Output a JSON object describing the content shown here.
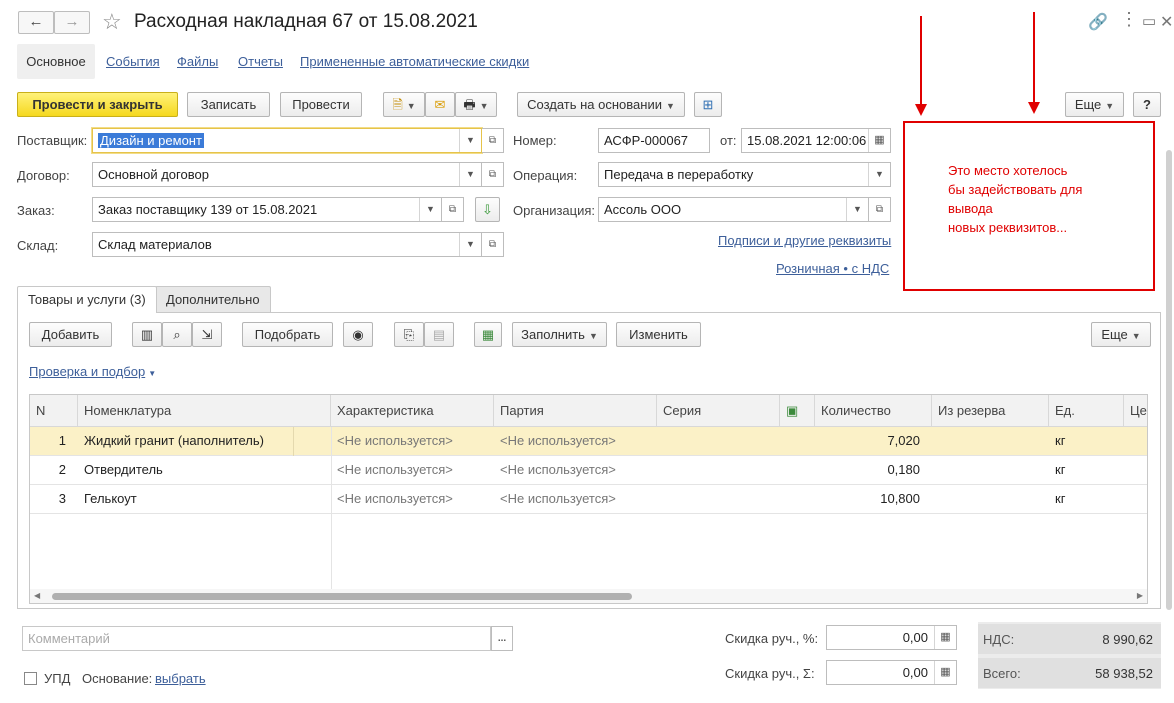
{
  "header": {
    "title": "Расходная накладная 67 от 15.08.2021",
    "back_glyph": "🡐",
    "forward_glyph": "🡒"
  },
  "top_tabs": [
    {
      "label": "Основное"
    },
    {
      "label": "События"
    },
    {
      "label": "Файлы"
    },
    {
      "label": "Отчеты"
    },
    {
      "label": "Примененные автоматические скидки"
    }
  ],
  "toolbar": {
    "post_close": "Провести и закрыть",
    "save": "Записать",
    "post": "Провести",
    "create_based": "Создать на основании",
    "more": "Еще",
    "help": "?"
  },
  "form": {
    "supplier_label": "Поставщик:",
    "supplier_value": "Дизайн и ремонт",
    "contract_label": "Договор:",
    "contract_value": "Основной договор",
    "order_label": "Заказ:",
    "order_value": "Заказ поставщику 139 от 15.08.2021",
    "warehouse_label": "Склад:",
    "warehouse_value": "Склад материалов",
    "number_label": "Номер:",
    "number_value": "АСФР-000067",
    "date_label": "от:",
    "date_value": "15.08.2021 12:00:06",
    "operation_label": "Операция:",
    "operation_value": "Передача в переработку",
    "org_label": "Организация:",
    "org_value": "Ассоль ООО",
    "link_signatures": "Подписи и другие реквизиты",
    "link_price": "Розничная • с НДС"
  },
  "annotation": {
    "lines": [
      "Это место хотелось",
      "бы задействовать для",
      "вывода",
      "новых реквизитов..."
    ]
  },
  "panel_tabs": [
    {
      "label": "Товары и услуги (3)"
    },
    {
      "label": "Дополнительно"
    }
  ],
  "panel_toolbar": {
    "add": "Добавить",
    "pick": "Подобрать",
    "fill": "Заполнить",
    "change": "Изменить",
    "more": "Еще",
    "check_link": "Проверка и подбор"
  },
  "table": {
    "columns": [
      "N",
      "Номенклатура",
      "Характеристика",
      "Партия",
      "Серия",
      "",
      "Количество",
      "Из резерва",
      "Ед.",
      "Цен"
    ],
    "rows": [
      {
        "n": "1",
        "name": "Жидкий гранит (наполнитель)",
        "char": "<Не используется>",
        "batch": "<Не используется>",
        "series": "",
        "qty": "7,020",
        "reserve": "",
        "unit": "кг"
      },
      {
        "n": "2",
        "name": "Отвердитель",
        "char": "<Не используется>",
        "batch": "<Не используется>",
        "series": "",
        "qty": "0,180",
        "reserve": "",
        "unit": "кг"
      },
      {
        "n": "3",
        "name": "Гелькоут",
        "char": "<Не используется>",
        "batch": "<Не используется>",
        "series": "",
        "qty": "10,800",
        "reserve": "",
        "unit": "кг"
      }
    ]
  },
  "footer": {
    "comment_placeholder": "Комментарий",
    "upd_label": "УПД",
    "basis_label": "Основание:",
    "basis_link": "выбрать",
    "discount_pct_label": "Скидка руч., %:",
    "discount_pct_value": "0,00",
    "discount_sum_label": "Скидка руч., Σ:",
    "discount_sum_value": "0,00",
    "vat_label": "НДС:",
    "vat_value": "8 990,62",
    "total_label": "Всего:",
    "total_value": "58 938,52"
  }
}
